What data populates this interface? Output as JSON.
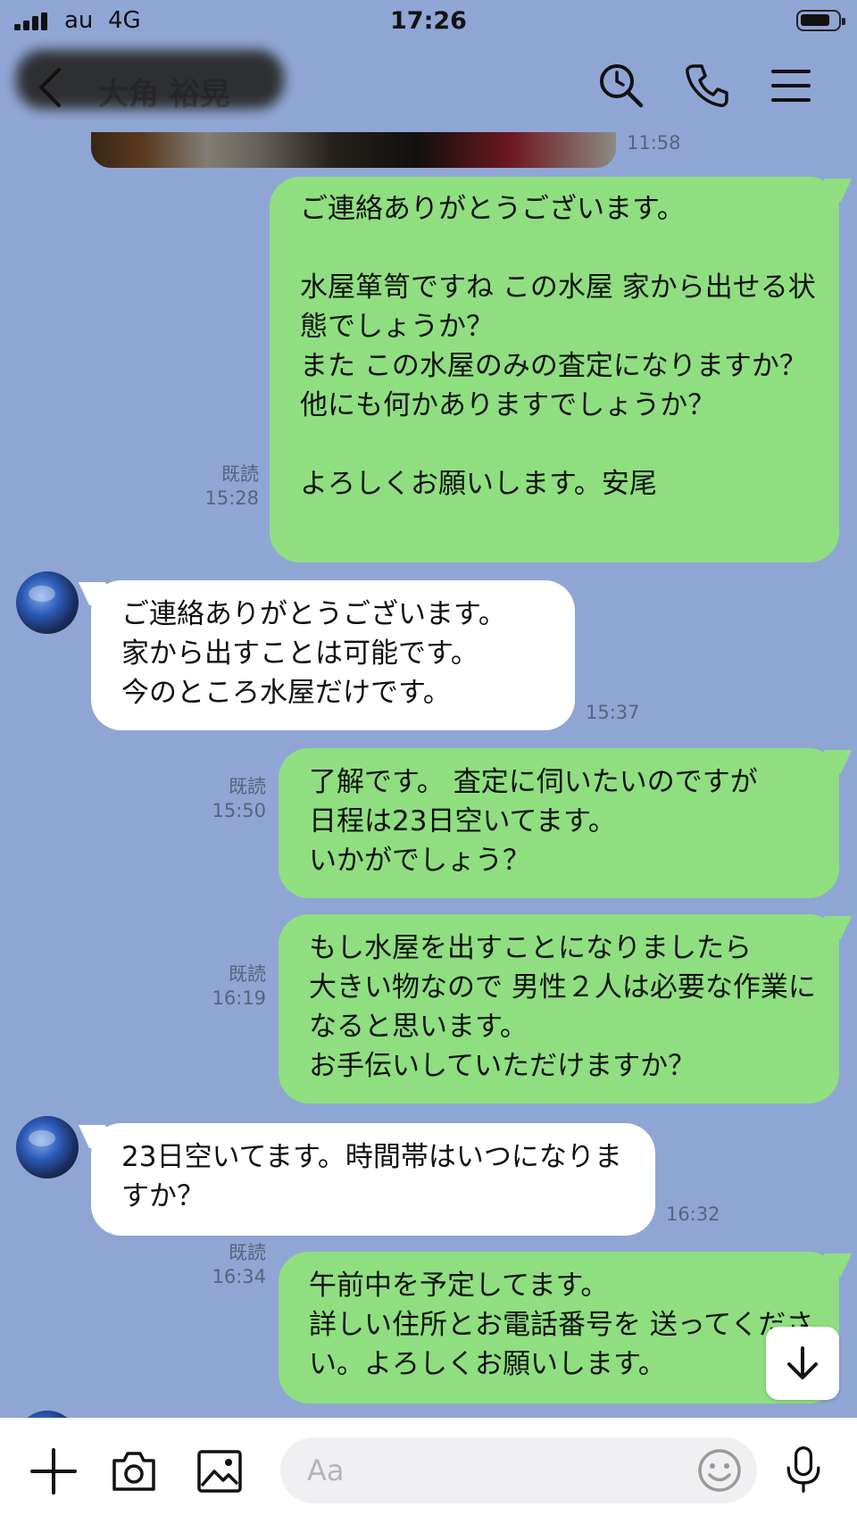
{
  "status_bar": {
    "carrier": "au",
    "network": "4G",
    "time": "17:26"
  },
  "header": {
    "chat_name": "大角 裕晃",
    "icons": [
      "chevron-left-icon",
      "search-icon",
      "phone-icon",
      "menu-icon"
    ]
  },
  "messages": [
    {
      "side": "in",
      "type": "image",
      "time": "11:58"
    },
    {
      "side": "out",
      "text": "ご連絡ありがとうございます。\n\n水屋箪笥ですね この水屋 家から出せる状態でしょうか？\nまた この水屋のみの査定になりますか？他にも何かありますでしょうか？\n\nよろしくお願いします。安尾",
      "read": "既読",
      "time": "15:28"
    },
    {
      "side": "in",
      "text": "ご連絡ありがとうございます。\n家から出すことは可能です。\n今のところ水屋だけです。",
      "time": "15:37"
    },
    {
      "side": "out",
      "text": "了解です。 査定に伺いたいのですが\n日程は23日空いてます。\nいかがでしょう？",
      "read": "既読",
      "time": "15:50"
    },
    {
      "side": "out",
      "text": "もし水屋を出すことになりましたら\n大きい物なので 男性２人は必要な作業になると思います。\nお手伝いしていただけますか？",
      "read": "既読",
      "time": "16:19"
    },
    {
      "side": "in",
      "text": "23日空いてます。時間帯はいつになりますか？",
      "time": "16:32"
    },
    {
      "side": "out",
      "text": "午前中を予定してます。\n詳しい住所とお電話番号を 送ってください。よろしくお願いします。",
      "read": "既読",
      "time": "16:34"
    }
  ],
  "scroll_button": {
    "icon": "arrow-down-icon"
  },
  "input_bar": {
    "placeholder": "Aa",
    "value": "",
    "icons": [
      "plus-icon",
      "camera-icon",
      "image-icon",
      "emoji-icon",
      "microphone-icon"
    ]
  },
  "colors": {
    "background": "#8fa6d4",
    "outgoing_bubble": "#8fdf80",
    "incoming_bubble": "#ffffff"
  }
}
